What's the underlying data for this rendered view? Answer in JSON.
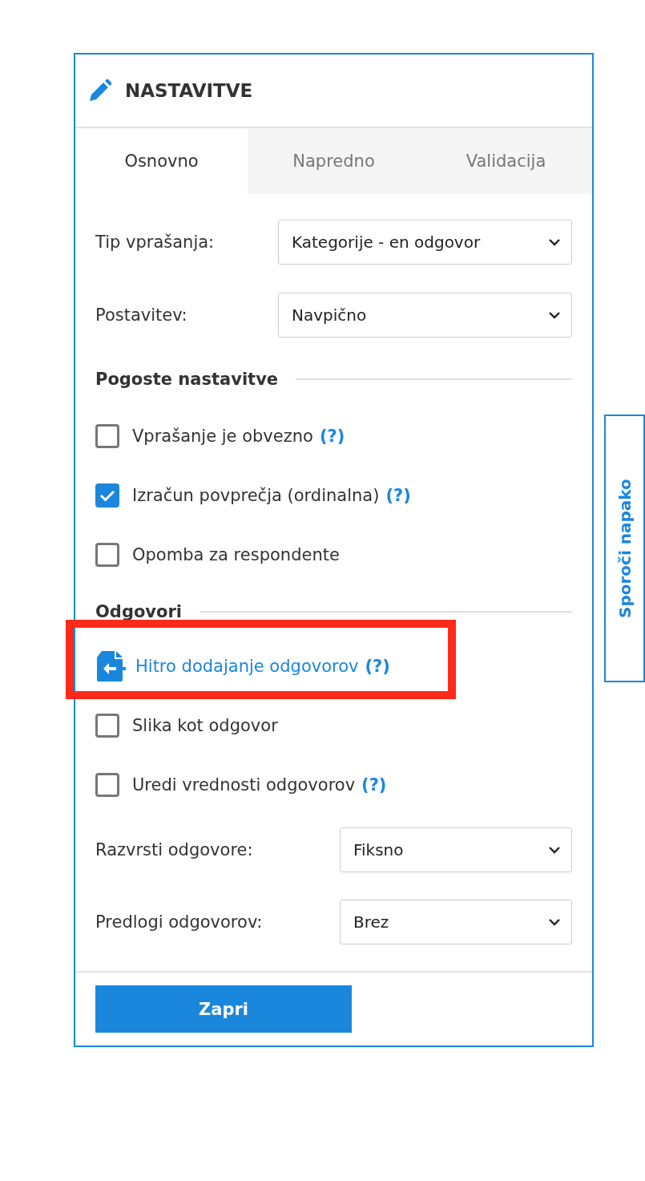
{
  "panel": {
    "title": "NASTAVITVE"
  },
  "tabs": [
    {
      "label": "Osnovno",
      "selected": true
    },
    {
      "label": "Napredno",
      "selected": false
    },
    {
      "label": "Validacija",
      "selected": false
    }
  ],
  "top_fields": [
    {
      "label": "Tip vprašanja:",
      "value": "Kategorije - en odgovor"
    },
    {
      "label": "Postavitev:",
      "value": "Navpično"
    }
  ],
  "common_settings": {
    "heading": "Pogoste nastavitve",
    "items": [
      {
        "label": "Vprašanje je obvezno",
        "help": "(?)",
        "checked": false
      },
      {
        "label": "Izračun povprečja (ordinalna)",
        "help": "(?)",
        "checked": true
      },
      {
        "label": "Opomba za respondente",
        "checked": false
      }
    ]
  },
  "answers": {
    "heading": "Odgovori",
    "quick_add": {
      "label": "Hitro dodajanje odgovorov",
      "help": "(?)",
      "highlighted": true
    },
    "items": [
      {
        "label": "Slika kot odgovor",
        "checked": false
      },
      {
        "label": "Uredi vrednosti odgovorov",
        "help": "(?)",
        "checked": false
      }
    ],
    "fields": [
      {
        "label": "Razvrsti odgovore:",
        "value": "Fiksno"
      },
      {
        "label": "Predlogi odgovorov:",
        "value": "Brez"
      }
    ]
  },
  "close_button": "Zapri",
  "side_button": "Sporoči napako"
}
